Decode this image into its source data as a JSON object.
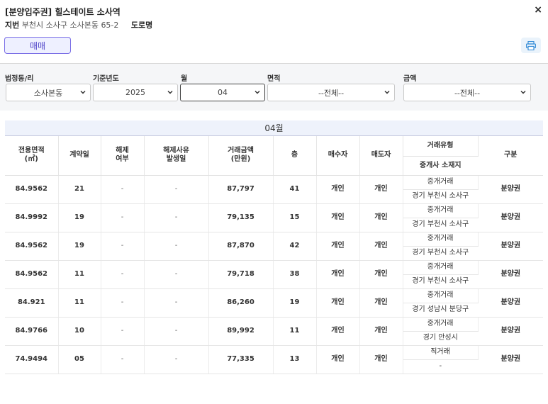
{
  "header": {
    "title": "[분양입주권] 힐스테이트 소사역",
    "addr_label": "지번",
    "addr_value": "부천시 소사구 소사본동 65-2",
    "road_label": "도로명",
    "close_label": "×",
    "trade_button": "매매"
  },
  "filters": {
    "dong_label": "법정동/리",
    "dong_value": "소사본동",
    "year_label": "기준년도",
    "year_value": "2025",
    "month_label": "월",
    "month_value": "04",
    "area_label": "면적",
    "area_value": "--전체--",
    "price_label": "금액",
    "price_value": "--전체--"
  },
  "table": {
    "month_title": "04월",
    "headers": {
      "area": "전용면적",
      "area_unit": "(㎡)",
      "day": "계약일",
      "cancel": "해제",
      "cancel2": "여부",
      "cancel_reason": "해제사유",
      "cancel_reason2": "발생일",
      "price": "거래금액",
      "price_unit": "(만원)",
      "floor": "층",
      "buyer": "매수자",
      "seller": "매도자",
      "trade_type": "거래유형",
      "broker_loc": "중개사 소재지",
      "category": "구분"
    },
    "rows": [
      {
        "area": "84.9562",
        "day": "21",
        "cancel": "-",
        "reason": "-",
        "price": "87,797",
        "floor": "41",
        "buyer": "개인",
        "seller": "개인",
        "type": "중개거래",
        "broker": "경기 부천시 소사구",
        "category": "분양권"
      },
      {
        "area": "84.9992",
        "day": "19",
        "cancel": "-",
        "reason": "-",
        "price": "79,135",
        "floor": "15",
        "buyer": "개인",
        "seller": "개인",
        "type": "중개거래",
        "broker": "경기 부천시 소사구",
        "category": "분양권"
      },
      {
        "area": "84.9562",
        "day": "19",
        "cancel": "-",
        "reason": "-",
        "price": "87,870",
        "floor": "42",
        "buyer": "개인",
        "seller": "개인",
        "type": "중개거래",
        "broker": "경기 부천시 소사구",
        "category": "분양권"
      },
      {
        "area": "84.9562",
        "day": "11",
        "cancel": "-",
        "reason": "-",
        "price": "79,718",
        "floor": "38",
        "buyer": "개인",
        "seller": "개인",
        "type": "중개거래",
        "broker": "경기 부천시 소사구",
        "category": "분양권"
      },
      {
        "area": "84.921",
        "day": "11",
        "cancel": "-",
        "reason": "-",
        "price": "86,260",
        "floor": "19",
        "buyer": "개인",
        "seller": "개인",
        "type": "중개거래",
        "broker": "경기 성남시 분당구",
        "category": "분양권"
      },
      {
        "area": "84.9766",
        "day": "10",
        "cancel": "-",
        "reason": "-",
        "price": "89,992",
        "floor": "11",
        "buyer": "개인",
        "seller": "개인",
        "type": "중개거래",
        "broker": "경기 안성시",
        "category": "분양권"
      },
      {
        "area": "74.9494",
        "day": "05",
        "cancel": "-",
        "reason": "-",
        "price": "77,335",
        "floor": "13",
        "buyer": "개인",
        "seller": "개인",
        "type": "직거래",
        "broker": "-",
        "category": "분양권"
      }
    ]
  },
  "colors": {
    "accent": "#4b40c7",
    "accent_bg": "#eef0ff",
    "filter_bg": "#f5f6f8",
    "month_band": "#eef2fb"
  }
}
